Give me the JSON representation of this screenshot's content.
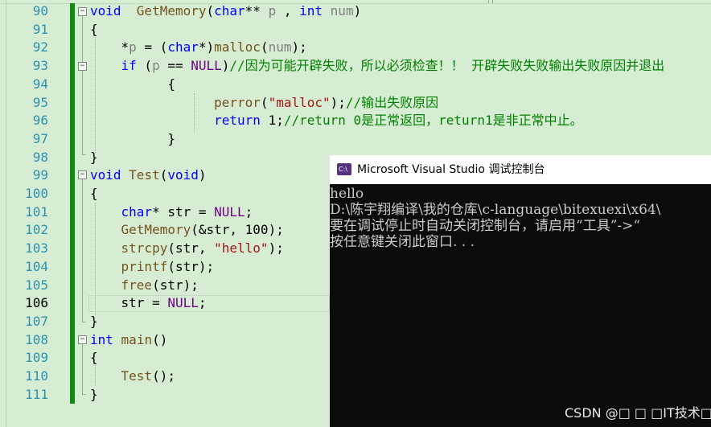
{
  "editor": {
    "lines": [
      {
        "no": "90",
        "segs": [
          [
            "kw",
            "void"
          ],
          [
            "",
            "  "
          ],
          [
            "fn",
            "GetMemory"
          ],
          [
            "",
            "("
          ],
          [
            "kw",
            "char"
          ],
          [
            "",
            "** "
          ],
          [
            "pa",
            "p"
          ],
          [
            "",
            " , "
          ],
          [
            "kw",
            "int"
          ],
          [
            "",
            " "
          ],
          [
            "pa",
            "num"
          ],
          [
            "",
            ")"
          ]
        ]
      },
      {
        "no": "91",
        "segs": [
          [
            "",
            "{"
          ]
        ]
      },
      {
        "no": "92",
        "segs": [
          [
            "",
            "    *"
          ],
          [
            "pa",
            "p"
          ],
          [
            "",
            " = ("
          ],
          [
            "kw",
            "char"
          ],
          [
            "",
            "*)"
          ],
          [
            "fn",
            "malloc"
          ],
          [
            "",
            "("
          ],
          [
            "pa",
            "num"
          ],
          [
            "",
            ");"
          ]
        ]
      },
      {
        "no": "93",
        "segs": [
          [
            "",
            "    "
          ],
          [
            "kw",
            "if"
          ],
          [
            "",
            " ("
          ],
          [
            "pa",
            "p"
          ],
          [
            "",
            " == "
          ],
          [
            "mac",
            "NULL"
          ],
          [
            "",
            ")"
          ],
          [
            "cmt",
            "//因为可能开辟失败，所以必须检查！！ 开辟失败失败输出失败原因并退出"
          ]
        ]
      },
      {
        "no": "94",
        "segs": [
          [
            "",
            "          {"
          ]
        ]
      },
      {
        "no": "95",
        "segs": [
          [
            "",
            "                "
          ],
          [
            "fn",
            "perror"
          ],
          [
            "",
            "("
          ],
          [
            "str",
            "\"malloc\""
          ],
          [
            "",
            ");"
          ],
          [
            "cmt",
            "//输出失败原因"
          ]
        ]
      },
      {
        "no": "96",
        "segs": [
          [
            "",
            "                "
          ],
          [
            "kw",
            "return"
          ],
          [
            "",
            " 1;"
          ],
          [
            "cmt",
            "//return 0是正常返回，return1是非正常中止。"
          ]
        ]
      },
      {
        "no": "97",
        "segs": [
          [
            "",
            "          }"
          ]
        ]
      },
      {
        "no": "98",
        "segs": [
          [
            "",
            "}"
          ]
        ]
      },
      {
        "no": "99",
        "segs": [
          [
            "kw",
            "void"
          ],
          [
            "",
            " "
          ],
          [
            "fn",
            "Test"
          ],
          [
            "",
            "("
          ],
          [
            "kw",
            "void"
          ],
          [
            "",
            ")"
          ]
        ]
      },
      {
        "no": "100",
        "segs": [
          [
            "",
            "{"
          ]
        ]
      },
      {
        "no": "101",
        "segs": [
          [
            "",
            "    "
          ],
          [
            "kw",
            "char"
          ],
          [
            "",
            "* str = "
          ],
          [
            "mac",
            "NULL"
          ],
          [
            "",
            ";"
          ]
        ]
      },
      {
        "no": "102",
        "segs": [
          [
            "",
            "    "
          ],
          [
            "fn",
            "GetMemory"
          ],
          [
            "",
            "(&str, 100);"
          ]
        ]
      },
      {
        "no": "103",
        "segs": [
          [
            "",
            "    "
          ],
          [
            "fn",
            "strcpy"
          ],
          [
            "",
            "(str, "
          ],
          [
            "str",
            "\"hello\""
          ],
          [
            "",
            ");"
          ]
        ]
      },
      {
        "no": "104",
        "segs": [
          [
            "",
            "    "
          ],
          [
            "fn",
            "printf"
          ],
          [
            "",
            "(str);"
          ]
        ]
      },
      {
        "no": "105",
        "segs": [
          [
            "",
            "    "
          ],
          [
            "fn",
            "free"
          ],
          [
            "",
            "(str);"
          ]
        ]
      },
      {
        "no": "106",
        "segs": [
          [
            "",
            "    str = "
          ],
          [
            "mac",
            "NULL"
          ],
          [
            "",
            ";"
          ]
        ]
      },
      {
        "no": "107",
        "segs": [
          [
            "",
            "}"
          ]
        ]
      },
      {
        "no": "108",
        "segs": [
          [
            "kw",
            "int"
          ],
          [
            "",
            " "
          ],
          [
            "fn",
            "main"
          ],
          [
            "",
            "()"
          ]
        ]
      },
      {
        "no": "109",
        "segs": [
          [
            "",
            "{"
          ]
        ]
      },
      {
        "no": "110",
        "segs": [
          [
            "",
            "    "
          ],
          [
            "fn",
            "Test"
          ],
          [
            "",
            "();"
          ]
        ]
      },
      {
        "no": "111",
        "segs": [
          [
            "",
            "}"
          ]
        ]
      }
    ],
    "current_line": "106",
    "colors": {
      "background": "#d7edd3",
      "keyword": "#0000ff",
      "string": "#a31515",
      "comment": "#008000",
      "macro": "#6f008a",
      "line_number": "#2b91af",
      "change_bar": "#108c10"
    }
  },
  "console": {
    "icon": "console-app-icon",
    "icon_text": "C:\\",
    "title": "Microsoft Visual Studio 调试控制台",
    "output": [
      "hello",
      "D:\\陈宇翔编译\\我的仓库\\c-language\\bitexuexi\\x64\\",
      "要在调试停止时自动关闭控制台，请启用“工具”->“",
      "按任意键关闭此窗口. . ."
    ]
  },
  "watermark": "CSDN @□ □ □IT技术□"
}
